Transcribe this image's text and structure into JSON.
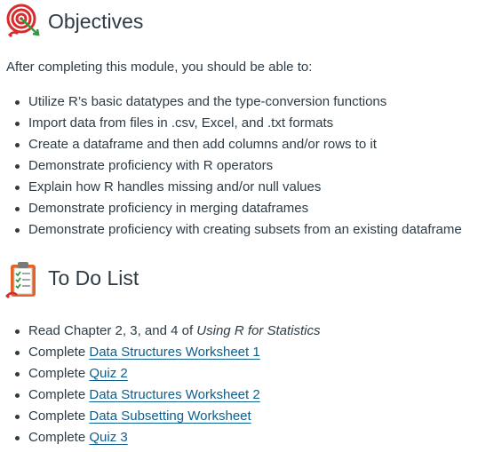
{
  "objectives": {
    "icon": "target-icon",
    "title": "Objectives",
    "intro": "After completing this module, you should be able to:",
    "items": [
      "Utilize R’s basic datatypes and the type-conversion functions",
      "Import data from files in .csv, Excel, and .txt formats",
      "Create a dataframe and then add columns and/or rows to it",
      "Demonstrate proficiency with R operators",
      "Explain how R handles missing and/or null values",
      "Demonstrate proficiency in merging dataframes",
      "Demonstrate proficiency with creating subsets from an existing dataframe"
    ]
  },
  "todo": {
    "icon": "clipboard-checklist-icon",
    "title": "To Do List",
    "items": [
      {
        "prefix": "Read Chapter 2, 3, and 4 of ",
        "italic": "Using R for Statistics"
      },
      {
        "prefix": "Complete ",
        "link": "Data Structures Worksheet 1"
      },
      {
        "prefix": "Complete ",
        "link": "Quiz 2"
      },
      {
        "prefix": "Complete ",
        "link": "Data Structures Worksheet 2"
      },
      {
        "prefix": "Complete ",
        "link": "Data Subsetting Worksheet"
      },
      {
        "prefix": "Complete ",
        "link": "Quiz 3"
      }
    ]
  },
  "colors": {
    "text": "#2d3b45",
    "link": "#0e5e8c",
    "icon_red": "#d92b2b",
    "icon_green": "#2e9a3a",
    "clipboard": "#e2642b"
  }
}
